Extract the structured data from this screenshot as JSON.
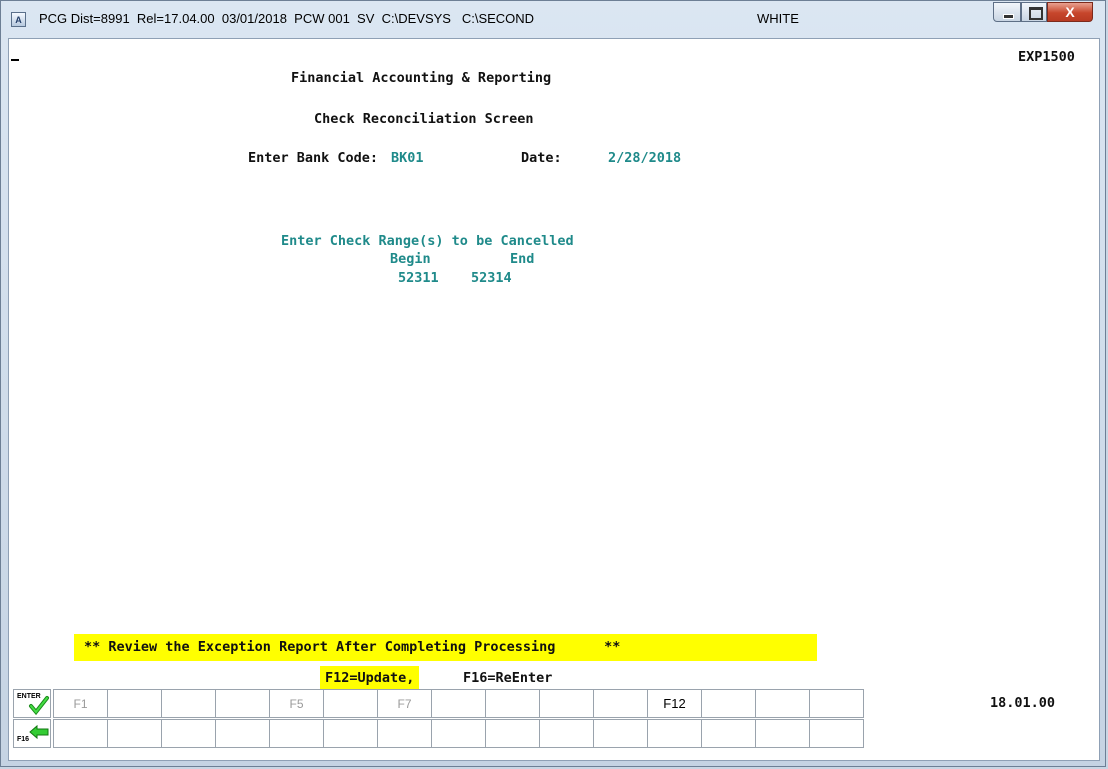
{
  "window": {
    "app_icon_letter": "A",
    "title_segments": [
      "PCG Dist=8991",
      "Rel=17.04.00",
      "03/01/2018",
      "PCW 001",
      "SV",
      "C:\\DEVSYS",
      "C:\\SECOND"
    ],
    "title_right": "WHITE",
    "close_glyph": "X"
  },
  "screen": {
    "program_id": "EXP1500",
    "heading": "Financial Accounting & Reporting",
    "subheading": "Check Reconciliation Screen",
    "bank_code_label": "Enter Bank Code:",
    "bank_code_value": "BK01",
    "date_label": "Date:",
    "date_value": "2/28/2018",
    "range_prompt": "Enter Check Range(s) to be Cancelled",
    "begin_label": "Begin",
    "end_label": "End",
    "begin_value": "52311",
    "end_value": "52314",
    "message": "** Review the Exception Report After Completing Processing      **",
    "f12_action": "F12=Update,",
    "f16_action": "F16=ReEnter",
    "version": "18.01.00"
  },
  "fkeys": {
    "enter_label": "ENTER",
    "f16_label": "F16",
    "row1": [
      "F1",
      "",
      "",
      "",
      "F5",
      "",
      "F7",
      "",
      "",
      "",
      "",
      "F12",
      "",
      "",
      ""
    ],
    "row2": [
      "",
      "",
      "",
      "",
      "",
      "",
      "",
      "",
      "",
      "",
      "",
      "",
      "",
      "",
      ""
    ],
    "enter_icon": "checkmark-icon",
    "f16_icon": "left-arrow-icon",
    "accent_green": "#33cc33"
  }
}
